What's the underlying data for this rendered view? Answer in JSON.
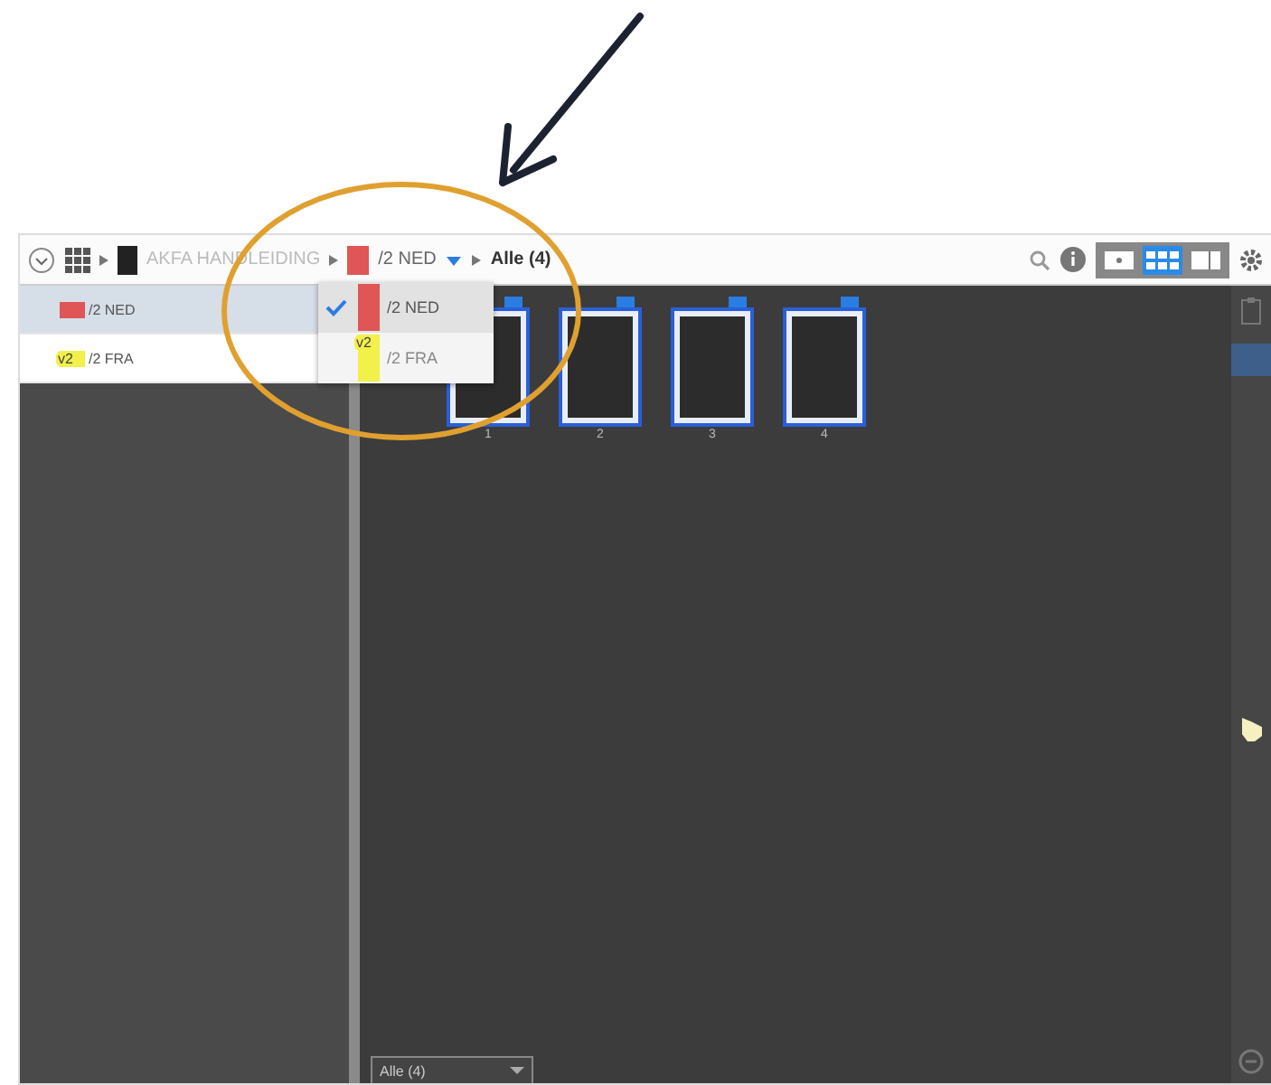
{
  "toolbar": {
    "document": "AKFA HANDLEIDING",
    "language": {
      "label": "/2  NED",
      "color": "#e05555"
    },
    "filter": "Alle (4)",
    "view_modes": [
      {
        "kind": "single",
        "selected": false
      },
      {
        "kind": "grid",
        "selected": true
      },
      {
        "kind": "spread",
        "selected": false
      }
    ]
  },
  "languages": [
    {
      "label": "/2 NED",
      "color": "#e05555",
      "selected": true
    },
    {
      "label": "/2 FRA",
      "color": "#f2f04a",
      "badge": "v2",
      "selected": false
    }
  ],
  "dropdown": [
    {
      "label": "/2  NED",
      "color": "#e05555",
      "selected": true
    },
    {
      "label": "/2  FRA",
      "color": "#f2f04a",
      "badge": "v2",
      "selected": false
    }
  ],
  "pages": [
    {
      "number": "1"
    },
    {
      "number": "2"
    },
    {
      "number": "3"
    },
    {
      "number": "4"
    }
  ],
  "bottom_filter": "Alle (4)"
}
